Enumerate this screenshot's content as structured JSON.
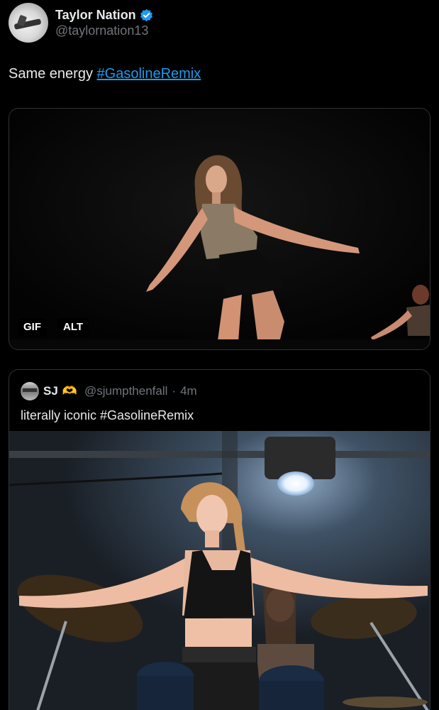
{
  "author": {
    "display_name": "Taylor Nation",
    "handle": "@taylornation13",
    "verified": true
  },
  "tweet": {
    "text": "Same energy ",
    "hashtag": "#GasolineRemix"
  },
  "media": {
    "badges": [
      "GIF",
      "ALT"
    ]
  },
  "quote": {
    "display_name": "SJ",
    "emoji": "🫶",
    "handle": "@sjumpthenfall",
    "separator": "·",
    "time": "4m",
    "text": "literally iconic #GasolineRemix"
  },
  "colors": {
    "accent": "#1d9bf0",
    "background": "#000000",
    "secondary_text": "#71767b",
    "border": "#2f3336"
  }
}
